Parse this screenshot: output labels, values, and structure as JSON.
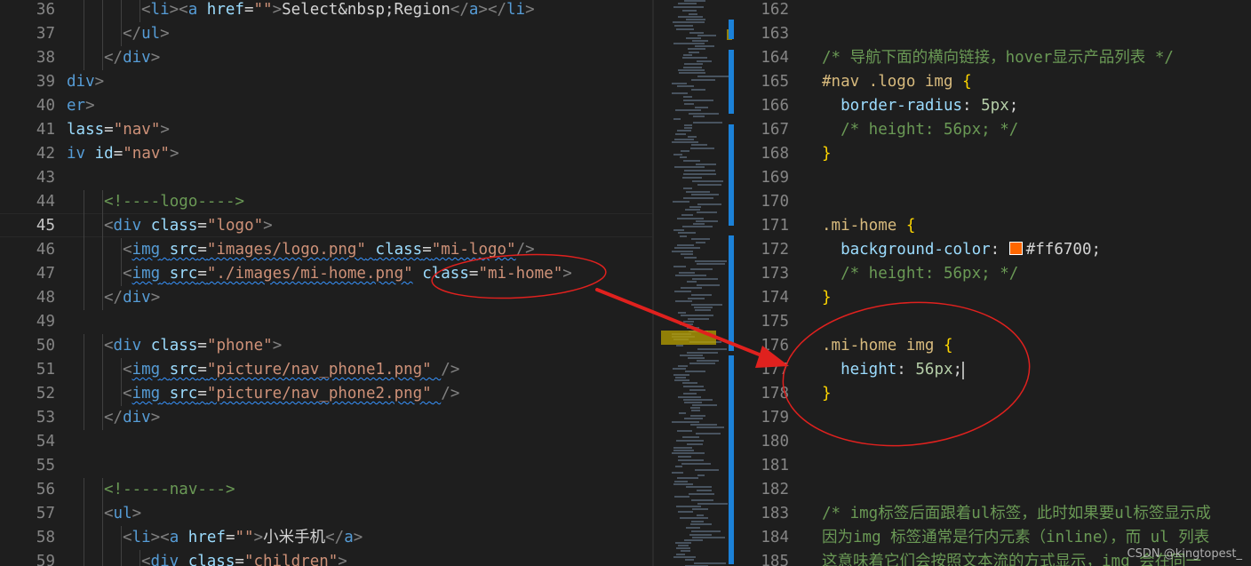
{
  "left_editor": {
    "active_line": "45",
    "lines": [
      {
        "n": "36",
        "indent": 4,
        "tokens": [
          [
            "punct",
            "<"
          ],
          [
            "tag",
            "li"
          ],
          [
            "punct",
            "><"
          ],
          [
            "tag",
            "a"
          ],
          [
            "plain",
            " "
          ],
          [
            "attr",
            "href"
          ],
          [
            "plain",
            "="
          ],
          [
            "str",
            "\"\""
          ],
          [
            "punct",
            ">"
          ],
          [
            "text",
            "Select&nbsp;Region"
          ],
          [
            "punct",
            "</"
          ],
          [
            "tag",
            "a"
          ],
          [
            "punct",
            "></"
          ],
          [
            "tag",
            "li"
          ],
          [
            "punct",
            ">"
          ]
        ]
      },
      {
        "n": "37",
        "indent": 3,
        "tokens": [
          [
            "punct",
            "</"
          ],
          [
            "tag",
            "ul"
          ],
          [
            "punct",
            ">"
          ]
        ]
      },
      {
        "n": "38",
        "indent": 2,
        "tokens": [
          [
            "punct",
            "</"
          ],
          [
            "tag",
            "div"
          ],
          [
            "punct",
            ">"
          ]
        ]
      },
      {
        "n": "39",
        "indent": 0,
        "tokens": [
          [
            "tag",
            "div"
          ],
          [
            "punct",
            ">"
          ]
        ]
      },
      {
        "n": "40",
        "indent": 0,
        "tokens": [
          [
            "tag",
            "er"
          ],
          [
            "punct",
            ">"
          ]
        ]
      },
      {
        "n": "41",
        "indent": 0,
        "tokens": [
          [
            "attr",
            "lass"
          ],
          [
            "plain",
            "="
          ],
          [
            "str",
            "\"nav\""
          ],
          [
            "punct",
            ">"
          ]
        ]
      },
      {
        "n": "42",
        "indent": 0,
        "tokens": [
          [
            "tag",
            "iv"
          ],
          [
            "plain",
            " "
          ],
          [
            "attr",
            "id"
          ],
          [
            "plain",
            "="
          ],
          [
            "str",
            "\"nav\""
          ],
          [
            "punct",
            ">"
          ]
        ]
      },
      {
        "n": "43",
        "indent": 0,
        "tokens": []
      },
      {
        "n": "44",
        "indent": 2,
        "tokens": [
          [
            "comment",
            "<!----logo---->"
          ]
        ]
      },
      {
        "n": "45",
        "indent": 2,
        "tokens": [
          [
            "punct",
            "<"
          ],
          [
            "tag",
            "div"
          ],
          [
            "plain",
            " "
          ],
          [
            "attr",
            "class"
          ],
          [
            "plain",
            "="
          ],
          [
            "str",
            "\"logo\""
          ],
          [
            "punct",
            ">"
          ]
        ]
      },
      {
        "n": "46",
        "indent": 3,
        "tokens": [
          [
            "punct",
            "<"
          ],
          [
            "tag",
            "img",
            "sq"
          ],
          [
            "plain",
            " ",
            "sq"
          ],
          [
            "attr",
            "src",
            "sq"
          ],
          [
            "plain",
            "=",
            "sq"
          ],
          [
            "str",
            "\"images/logo.png\"",
            "sq"
          ],
          [
            "plain",
            " ",
            "sq"
          ],
          [
            "attr",
            "class",
            "sq"
          ],
          [
            "plain",
            "=",
            "sq"
          ],
          [
            "str",
            "\"mi-logo\"",
            "sq"
          ],
          [
            "punct",
            "/>"
          ]
        ]
      },
      {
        "n": "47",
        "indent": 3,
        "tokens": [
          [
            "punct",
            "<"
          ],
          [
            "tag",
            "img",
            "sq"
          ],
          [
            "plain",
            " ",
            "sq"
          ],
          [
            "attr",
            "src",
            "sq"
          ],
          [
            "plain",
            "=",
            "sq"
          ],
          [
            "str",
            "\"./images/mi-home.png\"",
            "sq"
          ],
          [
            "plain",
            " "
          ],
          [
            "attr",
            "class"
          ],
          [
            "plain",
            "="
          ],
          [
            "str",
            "\"mi-home\""
          ],
          [
            "punct",
            ">"
          ]
        ]
      },
      {
        "n": "48",
        "indent": 2,
        "tokens": [
          [
            "punct",
            "</"
          ],
          [
            "tag",
            "div"
          ],
          [
            "punct",
            ">"
          ]
        ]
      },
      {
        "n": "49",
        "indent": 0,
        "tokens": []
      },
      {
        "n": "50",
        "indent": 2,
        "tokens": [
          [
            "punct",
            "<"
          ],
          [
            "tag",
            "div"
          ],
          [
            "plain",
            " "
          ],
          [
            "attr",
            "class"
          ],
          [
            "plain",
            "="
          ],
          [
            "str",
            "\"phone\""
          ],
          [
            "punct",
            ">"
          ]
        ]
      },
      {
        "n": "51",
        "indent": 3,
        "tokens": [
          [
            "punct",
            "<"
          ],
          [
            "tag",
            "img",
            "sq"
          ],
          [
            "plain",
            " ",
            "sq"
          ],
          [
            "attr",
            "src",
            "sq"
          ],
          [
            "plain",
            "=",
            "sq"
          ],
          [
            "str",
            "\"picture/nav_phone1.png\"",
            "sq"
          ],
          [
            "plain",
            " ",
            "sq"
          ],
          [
            "punct",
            "/>"
          ]
        ]
      },
      {
        "n": "52",
        "indent": 3,
        "tokens": [
          [
            "punct",
            "<"
          ],
          [
            "tag",
            "img",
            "sq"
          ],
          [
            "plain",
            " ",
            "sq"
          ],
          [
            "attr",
            "src",
            "sq"
          ],
          [
            "plain",
            "=",
            "sq"
          ],
          [
            "str",
            "\"picture/nav_phone2.png\"",
            "sq"
          ],
          [
            "plain",
            " ",
            "sq"
          ],
          [
            "punct",
            "/>"
          ]
        ]
      },
      {
        "n": "53",
        "indent": 2,
        "tokens": [
          [
            "punct",
            "</"
          ],
          [
            "tag",
            "div"
          ],
          [
            "punct",
            ">"
          ]
        ]
      },
      {
        "n": "54",
        "indent": 0,
        "tokens": []
      },
      {
        "n": "55",
        "indent": 0,
        "tokens": []
      },
      {
        "n": "56",
        "indent": 2,
        "tokens": [
          [
            "comment",
            "<!-----nav--->"
          ]
        ]
      },
      {
        "n": "57",
        "indent": 2,
        "tokens": [
          [
            "punct",
            "<"
          ],
          [
            "tag",
            "ul"
          ],
          [
            "punct",
            ">"
          ]
        ]
      },
      {
        "n": "58",
        "indent": 3,
        "tokens": [
          [
            "punct",
            "<"
          ],
          [
            "tag",
            "li"
          ],
          [
            "punct",
            "><"
          ],
          [
            "tag",
            "a"
          ],
          [
            "plain",
            " "
          ],
          [
            "attr",
            "href"
          ],
          [
            "plain",
            "="
          ],
          [
            "str",
            "\"\""
          ],
          [
            "punct",
            ">"
          ],
          [
            "text",
            "小米手机"
          ],
          [
            "punct",
            "</"
          ],
          [
            "tag",
            "a"
          ],
          [
            "punct",
            ">"
          ]
        ]
      },
      {
        "n": "59",
        "indent": 4,
        "tokens": [
          [
            "punct",
            "<"
          ],
          [
            "tag",
            "div"
          ],
          [
            "plain",
            " "
          ],
          [
            "attr",
            "class"
          ],
          [
            "plain",
            "="
          ],
          [
            "str",
            "\"children\""
          ],
          [
            "punct",
            ">"
          ]
        ]
      }
    ]
  },
  "right_editor": {
    "lines": [
      {
        "n": "162",
        "tokens": []
      },
      {
        "n": "163",
        "tokens": []
      },
      {
        "n": "164",
        "tokens": [
          [
            "comment",
            "/* 导航下面的横向链接，hover显示产品列表 */"
          ]
        ]
      },
      {
        "n": "165",
        "tokens": [
          [
            "sel",
            "#nav .logo img"
          ],
          [
            "plain",
            " "
          ],
          [
            "brace",
            "{"
          ]
        ]
      },
      {
        "n": "166",
        "tokens": [
          [
            "plain",
            "  "
          ],
          [
            "prop",
            "border-radius"
          ],
          [
            "plain",
            ": "
          ],
          [
            "num",
            "5"
          ],
          [
            "unit",
            "px"
          ],
          [
            "plain",
            ";"
          ]
        ]
      },
      {
        "n": "167",
        "tokens": [
          [
            "plain",
            "  "
          ],
          [
            "comment",
            "/* height: 56px; */"
          ]
        ]
      },
      {
        "n": "168",
        "tokens": [
          [
            "brace",
            "}"
          ]
        ]
      },
      {
        "n": "169",
        "tokens": []
      },
      {
        "n": "170",
        "tokens": []
      },
      {
        "n": "171",
        "tokens": [
          [
            "sel",
            ".mi-home"
          ],
          [
            "plain",
            " "
          ],
          [
            "brace",
            "{"
          ]
        ]
      },
      {
        "n": "172",
        "tokens": [
          [
            "plain",
            "  "
          ],
          [
            "prop",
            "background-color"
          ],
          [
            "plain",
            ": "
          ],
          [
            "swatch",
            "#ff6700"
          ],
          [
            "plain",
            "#ff6700;"
          ]
        ]
      },
      {
        "n": "173",
        "tokens": [
          [
            "plain",
            "  "
          ],
          [
            "comment",
            "/* height: 56px; */"
          ]
        ]
      },
      {
        "n": "174",
        "tokens": [
          [
            "brace",
            "}"
          ]
        ]
      },
      {
        "n": "175",
        "tokens": []
      },
      {
        "n": "176",
        "tokens": [
          [
            "sel",
            ".mi-home img"
          ],
          [
            "plain",
            " "
          ],
          [
            "brace",
            "{"
          ]
        ]
      },
      {
        "n": "177",
        "tokens": [
          [
            "plain",
            "  "
          ],
          [
            "prop",
            "height"
          ],
          [
            "plain",
            ": "
          ],
          [
            "num",
            "56"
          ],
          [
            "unit",
            "px"
          ],
          [
            "plain",
            ";"
          ]
        ]
      },
      {
        "n": "178",
        "tokens": [
          [
            "brace",
            "}"
          ]
        ]
      },
      {
        "n": "179",
        "tokens": []
      },
      {
        "n": "180",
        "tokens": []
      },
      {
        "n": "181",
        "tokens": []
      },
      {
        "n": "182",
        "tokens": []
      },
      {
        "n": "183",
        "tokens": [
          [
            "comment",
            "/* img标签后面跟着ul标签，此时如果要ul标签显示成"
          ]
        ]
      },
      {
        "n": "184",
        "tokens": [
          [
            "comment",
            "因为img 标签通常是行内元素（inline），而 ul 列表"
          ]
        ]
      },
      {
        "n": "185",
        "tokens": [
          [
            "comment",
            "这意味着它们会按照文本流的方式显示，img 会在同一"
          ]
        ]
      }
    ]
  },
  "colors": {
    "background": "#1e1e1e",
    "annotation_red": "#e0211e",
    "change_bar_blue": "#1b81d8",
    "swatch_orange": "#ff6700"
  },
  "watermark": "CSDN @kingtopest_"
}
